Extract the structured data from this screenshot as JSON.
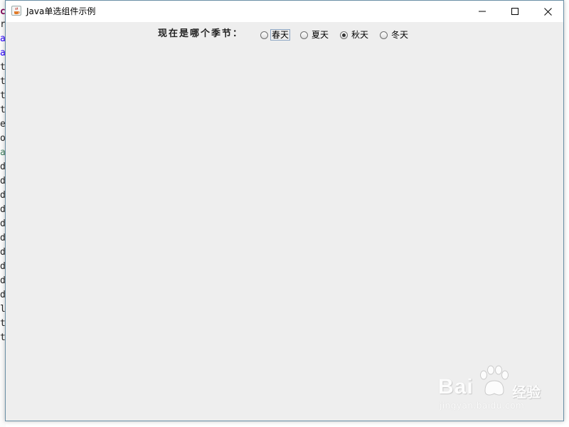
{
  "background_editor": {
    "chars": [
      "c",
      "r",
      "a",
      "a",
      "t",
      "t",
      "t",
      "t",
      "e",
      "o",
      "a",
      "d",
      "d",
      "d",
      "d",
      "d",
      "d",
      "d",
      "d",
      "d",
      "d",
      "l",
      "t",
      "t"
    ]
  },
  "window": {
    "title": "Java单选组件示例",
    "icons": {
      "app": "java-cup-icon",
      "minimize": "minimize-icon",
      "maximize": "maximize-icon",
      "close": "close-icon"
    }
  },
  "form": {
    "question_label": "现在是哪个季节：",
    "options": [
      {
        "label": "春天",
        "checked": false,
        "focused": true
      },
      {
        "label": "夏天",
        "checked": false,
        "focused": false
      },
      {
        "label": "秋天",
        "checked": true,
        "focused": false
      },
      {
        "label": "冬天",
        "checked": false,
        "focused": false
      }
    ],
    "selected": "秋天"
  },
  "watermark": {
    "brand": "Bai",
    "brand_suffix": "经验",
    "url": "jingyan.baidu.com"
  },
  "colors": {
    "content_background": "#eeeeee",
    "titlebar_background": "#ffffff",
    "window_border": "#6a8fa6"
  }
}
